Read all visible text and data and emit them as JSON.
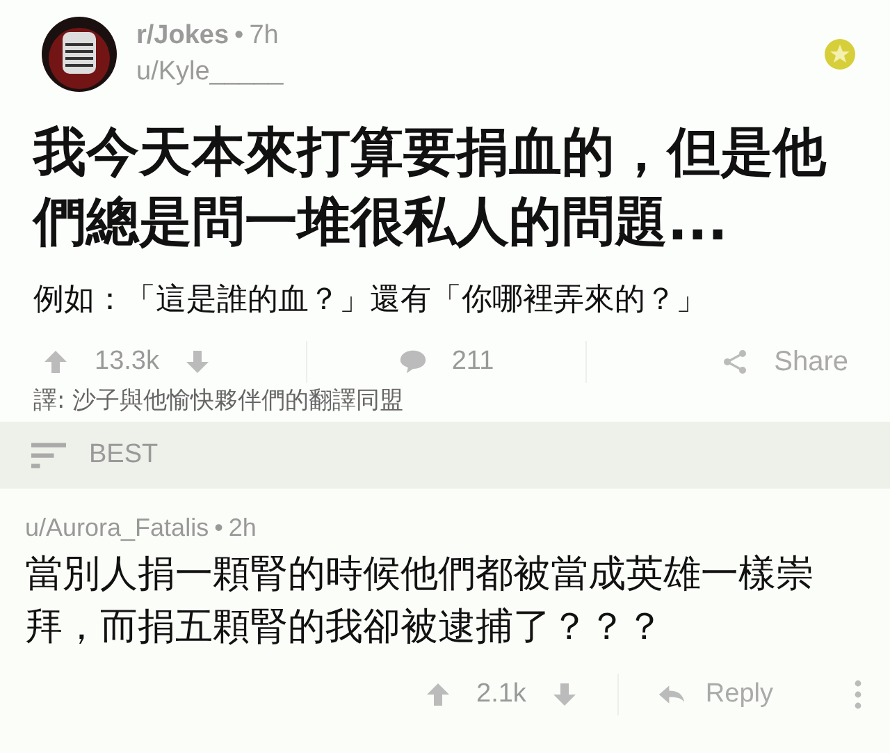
{
  "post": {
    "subreddit": "r/Jokes",
    "separator": "•",
    "age": "7h",
    "author": "u/Kyle_____",
    "title": "我今天本來打算要捐血的，但是他們總是問一堆很私人的問題...",
    "body": "例如：「這是誰的血？」還有「你哪裡弄來的？」",
    "score": "13.3k",
    "comments": "211",
    "share": "Share",
    "translator_credit": "譯: 沙子與他愉快夥伴們的翻譯同盟"
  },
  "sort": {
    "label": "BEST"
  },
  "comment": {
    "author": "u/Aurora_Fatalis",
    "separator": "•",
    "age": "2h",
    "text": "當別人捐一顆腎的時候他們都被當成英雄一樣崇拜，而捐五顆腎的我卻被逮捕了？？？",
    "score": "2.1k",
    "reply": "Reply"
  }
}
